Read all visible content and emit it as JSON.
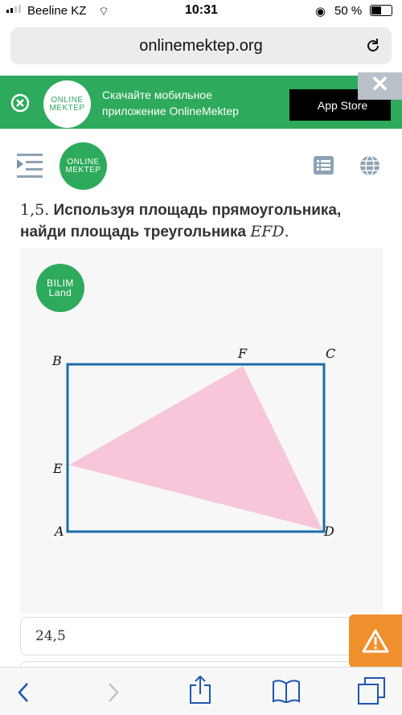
{
  "status": {
    "carrier": "Beeline KZ",
    "time": "10:31",
    "battery": "50 %"
  },
  "browser": {
    "url": "onlinemektep.org"
  },
  "banner": {
    "logo_line1": "ONLINE",
    "logo_line2": "MEKTEP",
    "text_line1": "Скачайте мобильное",
    "text_line2": "приложение OnlineMektep",
    "appstore_label": "App Store",
    "close_label": "✕"
  },
  "header": {
    "logo_line1": "ONLINE",
    "logo_line2": "MEKTEP"
  },
  "task": {
    "number": "1,5.",
    "text": " Используя площадь прямоугольника, найди площадь треугольника ",
    "math": "EFD",
    "end": "."
  },
  "card": {
    "badge_line1": "BILIM",
    "badge_line2": "Land"
  },
  "figure": {
    "labels": {
      "A": "A",
      "B": "B",
      "C": "C",
      "D": "D",
      "E": "E",
      "F": "F"
    },
    "rect_color": "#1a6ea8",
    "triangle_color": "#f7c6da"
  },
  "answer": {
    "value": "24,5"
  },
  "colors": {
    "brand_green": "#2eaa5c",
    "warning": "#f0902c"
  }
}
